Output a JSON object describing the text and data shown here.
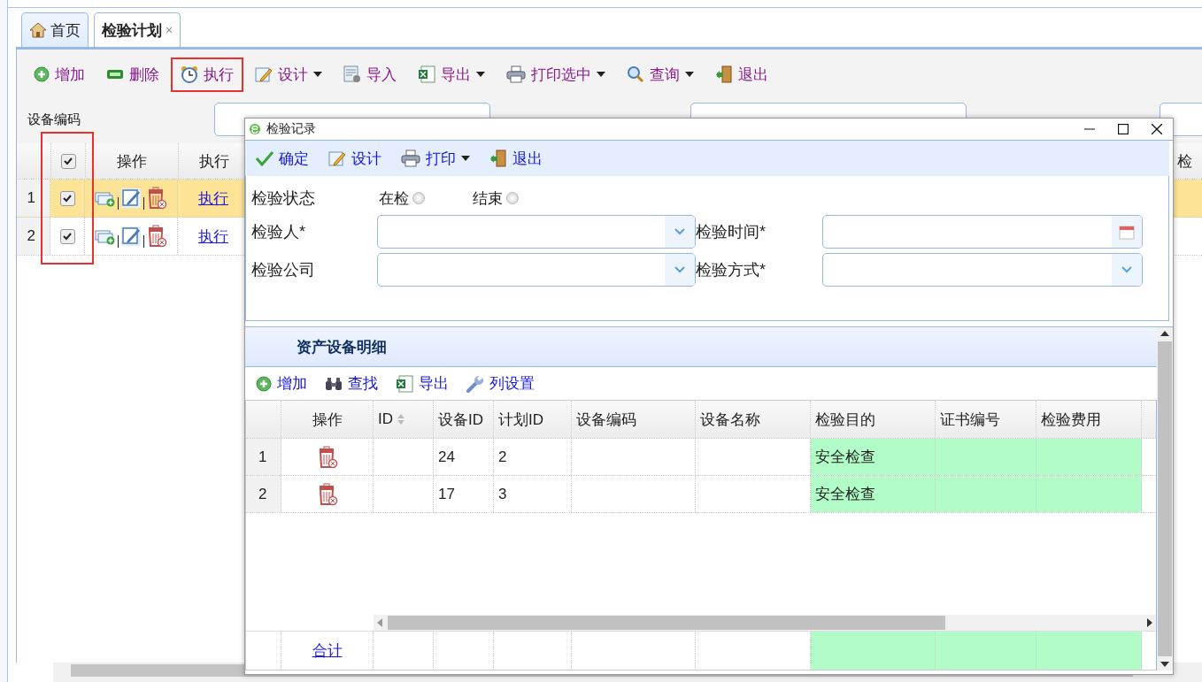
{
  "tabs": [
    {
      "label": "首页",
      "selected": false
    },
    {
      "label": "检验计划",
      "selected": true,
      "close": "×"
    }
  ],
  "toolbar": [
    {
      "label": "增加",
      "dropdown": false,
      "highlighted": false
    },
    {
      "label": "删除",
      "dropdown": false,
      "highlighted": false
    },
    {
      "label": "执行",
      "dropdown": false,
      "highlighted": true
    },
    {
      "label": "设计",
      "dropdown": true,
      "highlighted": false
    },
    {
      "label": "导入",
      "dropdown": false,
      "highlighted": false
    },
    {
      "label": "导出",
      "dropdown": true,
      "highlighted": false
    },
    {
      "label": "打印选中",
      "dropdown": true,
      "highlighted": false
    },
    {
      "label": "查询",
      "dropdown": true,
      "highlighted": false
    },
    {
      "label": "退出",
      "dropdown": false,
      "highlighted": false
    }
  ],
  "filter_label": "设备编码",
  "grid": {
    "checkbox_column_highlighted": true,
    "header_checked": true,
    "columns": [
      "操作",
      "执行",
      "检"
    ],
    "rows": [
      {
        "num": "1",
        "checked": true,
        "selected": true,
        "action": "执行"
      },
      {
        "num": "2",
        "checked": true,
        "selected": false,
        "action": "执行"
      }
    ]
  },
  "dialog": {
    "title": "检验记录",
    "toolbar": [
      {
        "label": "确定",
        "dropdown": false
      },
      {
        "label": "设计",
        "dropdown": false
      },
      {
        "label": "打印",
        "dropdown": true
      },
      {
        "label": "退出",
        "dropdown": false
      }
    ],
    "status": {
      "label": "检验状态",
      "options": [
        {
          "label": "在检",
          "selected": false
        },
        {
          "label": "结束",
          "selected": false
        }
      ]
    },
    "fields": [
      {
        "label": "检验人*",
        "kind": "combo"
      },
      {
        "label": "检验时间*",
        "kind": "date"
      },
      {
        "label": "检验公司",
        "kind": "combo"
      },
      {
        "label": "检验方式*",
        "kind": "combo"
      }
    ],
    "detail": {
      "title": "资产设备明细",
      "toolbar": [
        {
          "label": "增加"
        },
        {
          "label": "查找"
        },
        {
          "label": "导出"
        },
        {
          "label": "列设置"
        }
      ],
      "columns": [
        {
          "label": "操作",
          "sortable": false,
          "editable": false
        },
        {
          "label": "ID",
          "sortable": true,
          "editable": false
        },
        {
          "label": "设备ID",
          "sortable": false,
          "editable": false
        },
        {
          "label": "计划ID",
          "sortable": false,
          "editable": false
        },
        {
          "label": "设备编码",
          "sortable": false,
          "editable": false
        },
        {
          "label": "设备名称",
          "sortable": false,
          "editable": false
        },
        {
          "label": "检验目的",
          "sortable": false,
          "editable": true
        },
        {
          "label": "证书编号",
          "sortable": false,
          "editable": true
        },
        {
          "label": "检验费用",
          "sortable": false,
          "editable": true
        }
      ],
      "rows": [
        {
          "num": "1",
          "cells": [
            "",
            "",
            "24",
            "2",
            "",
            "",
            "安全检查",
            "",
            ""
          ]
        },
        {
          "num": "2",
          "cells": [
            "",
            "",
            "17",
            "3",
            "",
            "",
            "安全检查",
            "",
            ""
          ]
        }
      ],
      "footer": "合计"
    }
  }
}
